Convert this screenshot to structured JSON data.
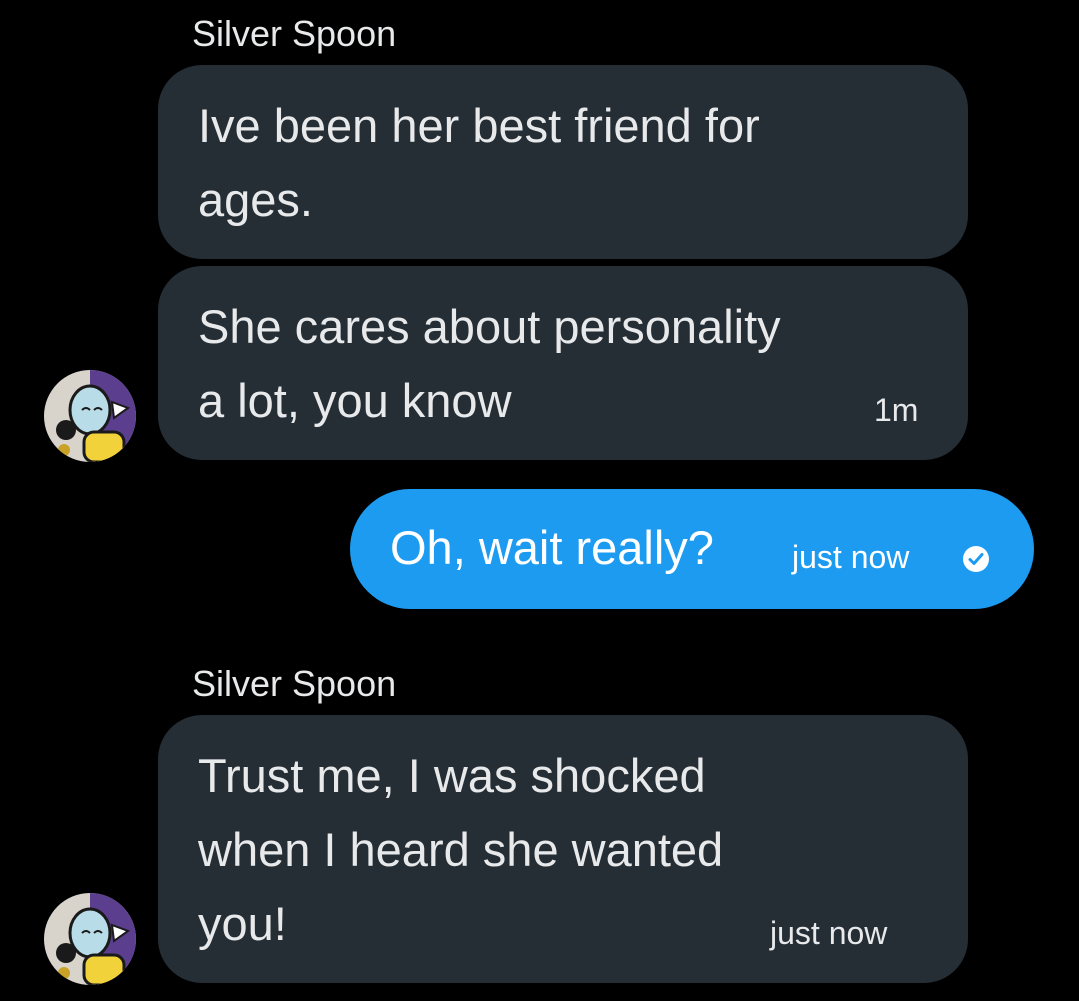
{
  "conversation": {
    "messages": [
      {
        "sender": "Silver Spoon",
        "direction": "incoming",
        "bubbles": [
          {
            "text": "Ive been her best friend for\nages."
          },
          {
            "text": "She cares about personality\na lot, you know",
            "timestamp": "1m"
          }
        ]
      },
      {
        "direction": "outgoing",
        "text": "Oh, wait really?",
        "timestamp": "just now",
        "status_icon": "check-circle-icon"
      },
      {
        "sender": "Silver Spoon",
        "direction": "incoming",
        "bubbles": [
          {
            "text": "Trust me, I was shocked\nwhen I heard she wanted\nyou!",
            "timestamp": "just now"
          }
        ]
      }
    ]
  },
  "colors": {
    "background": "#000000",
    "incoming_bubble": "#252d35",
    "outgoing_bubble": "#1d9bf0",
    "text": "#e7e9ea"
  }
}
